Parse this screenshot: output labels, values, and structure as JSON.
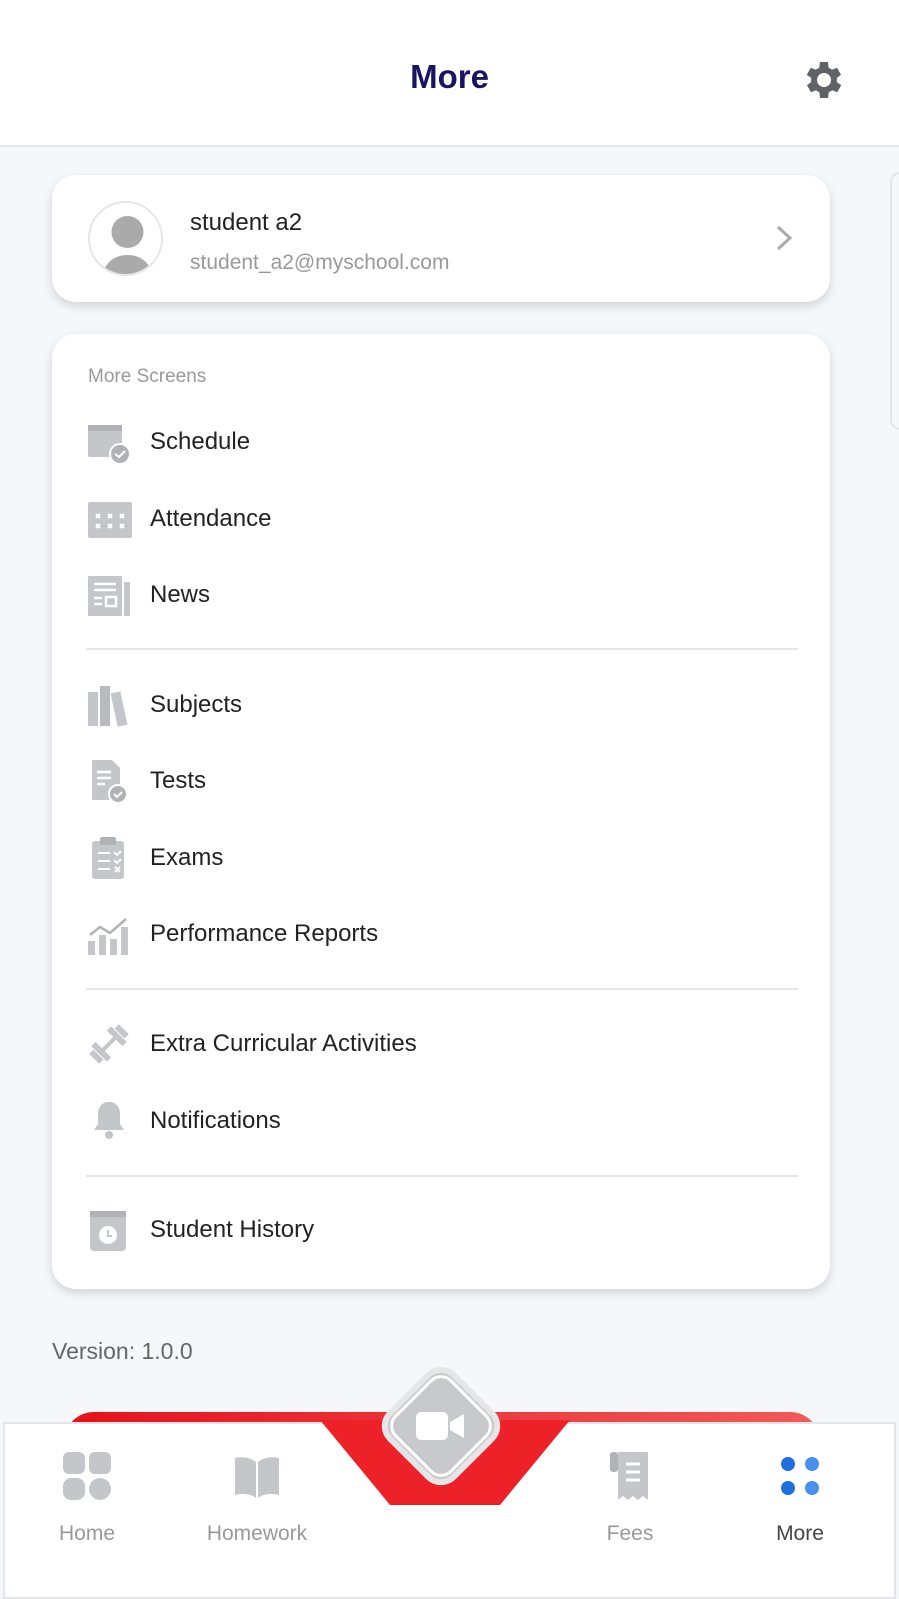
{
  "header": {
    "title": "More",
    "settings_icon": "gear-icon"
  },
  "profile": {
    "name": "student a2",
    "email": "student_a2@myschool.com"
  },
  "menu": {
    "section_label": "More Screens",
    "items": [
      {
        "label": "Schedule",
        "icon": "calendar-check-icon"
      },
      {
        "label": "Attendance",
        "icon": "calendar-grid-icon"
      },
      {
        "label": "News",
        "icon": "newspaper-icon"
      },
      {
        "label": "Subjects",
        "icon": "books-icon"
      },
      {
        "label": "Tests",
        "icon": "document-check-icon"
      },
      {
        "label": "Exams",
        "icon": "clipboard-icon"
      },
      {
        "label": "Performance Reports",
        "icon": "bar-chart-icon"
      },
      {
        "label": "Extra Curricular Activities",
        "icon": "dumbbell-icon"
      },
      {
        "label": "Notifications",
        "icon": "bell-icon"
      },
      {
        "label": "Student History",
        "icon": "history-book-icon"
      }
    ]
  },
  "version": "Version: 1.0.0",
  "nav": {
    "items": [
      {
        "label": "Home",
        "icon": "grid-icon"
      },
      {
        "label": "Homework",
        "icon": "open-book-icon"
      },
      {
        "label": "Fees",
        "icon": "receipt-icon"
      },
      {
        "label": "More",
        "icon": "dots-icon",
        "active": true
      }
    ],
    "center_icon": "video-camera-icon"
  },
  "colors": {
    "title": "#1b1462",
    "accent": "#2f80ed",
    "red": "#e5121a",
    "icon_gray": "#c4c6ca"
  }
}
